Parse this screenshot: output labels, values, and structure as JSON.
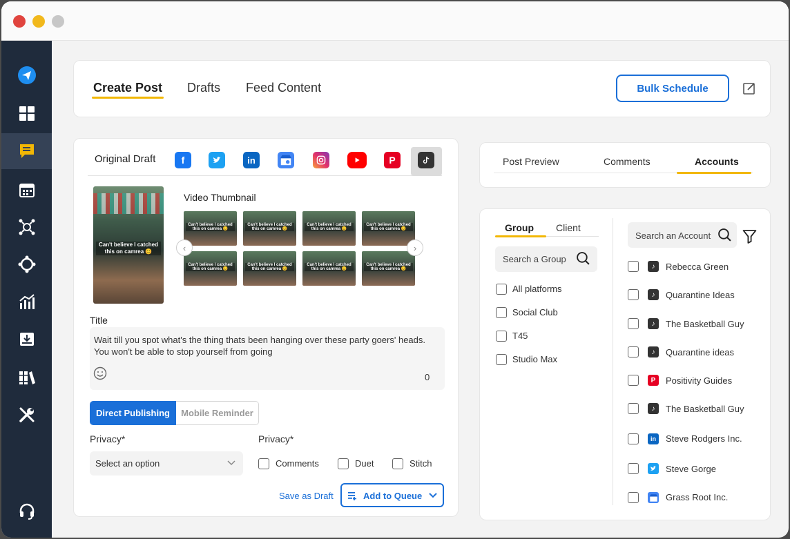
{
  "header": {
    "tabs": [
      {
        "label": "Create Post",
        "active": true
      },
      {
        "label": "Drafts",
        "active": false
      },
      {
        "label": "Feed Content",
        "active": false
      }
    ],
    "bulk_schedule_label": "Bulk Schedule"
  },
  "sidebar": {
    "icons": [
      "send-icon",
      "dashboard-icon",
      "compose-icon",
      "calendar-icon",
      "network-icon",
      "target-icon",
      "analytics-icon",
      "inbox-icon",
      "library-icon",
      "tools-icon",
      "support-icon"
    ],
    "active_index": 2
  },
  "editor": {
    "original_draft_label": "Original Draft",
    "platforms": [
      "facebook",
      "twitter",
      "linkedin",
      "google-business",
      "instagram",
      "youtube",
      "pinterest",
      "tiktok"
    ],
    "selected_platform": "tiktok",
    "video_thumbnail_label": "Video Thumbnail",
    "thumbnail_caption": "Can't believe I catched this on camrea 😊",
    "title_label": "Title",
    "title_text": "Wait till you spot what's the thing thats been hanging over these party goers' heads. You won't be able to stop yourself from going",
    "char_count": "0",
    "publish_modes": [
      "Direct Publishing",
      "Mobile Reminder"
    ],
    "active_publish_mode": "Direct Publishing",
    "privacy_label_1": "Privacy*",
    "privacy_label_2": "Privacy*",
    "select_placeholder": "Select an option",
    "privacy_options": [
      "Comments",
      "Duet",
      "Stitch"
    ],
    "save_draft_label": "Save as Draft",
    "add_to_queue_label": "Add to Queue"
  },
  "preview_tabs": [
    {
      "label": "Post Preview",
      "active": false
    },
    {
      "label": "Comments",
      "active": false
    },
    {
      "label": "Accounts",
      "active": true
    }
  ],
  "accounts": {
    "group_tab": "Group",
    "client_tab": "Client",
    "group_search_placeholder": "Search a Group",
    "groups": [
      "All platforms",
      "Social Club",
      "T45",
      "Studio Max"
    ],
    "account_search_placeholder": "Search an Account",
    "list": [
      {
        "name": "Rebecca Green",
        "platform": "tiktok"
      },
      {
        "name": "Quarantine Ideas",
        "platform": "tiktok"
      },
      {
        "name": "The Basketball Guy",
        "platform": "tiktok"
      },
      {
        "name": "Quarantine ideas",
        "platform": "tiktok"
      },
      {
        "name": "Positivity Guides",
        "platform": "pinterest"
      },
      {
        "name": "The Basketball Guy",
        "platform": "tiktok"
      },
      {
        "name": "Steve Rodgers Inc.",
        "platform": "linkedin"
      },
      {
        "name": "Steve Gorge",
        "platform": "twitter"
      },
      {
        "name": "Grass Root Inc.",
        "platform": "google-business"
      }
    ]
  },
  "colors": {
    "accent": "#1a6fd8",
    "tab_underline": "#f2b705",
    "sidebar_bg": "#1f2b3c"
  }
}
